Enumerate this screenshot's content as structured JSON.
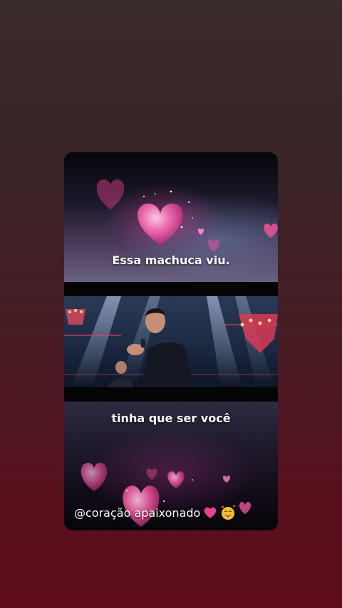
{
  "story": {
    "caption_top": "Essa machuca viu.",
    "caption_bottom": "tinha que ser você",
    "mention": "@coração apaixonado",
    "mention_emojis": [
      "red-heart-icon",
      "smiling-face-with-hearts-icon"
    ]
  },
  "colors": {
    "background_top": "#3a2b2d",
    "background_bottom": "#5e0c1a",
    "heart_pink": "#e8559a",
    "caption_text": "#ffffff"
  }
}
